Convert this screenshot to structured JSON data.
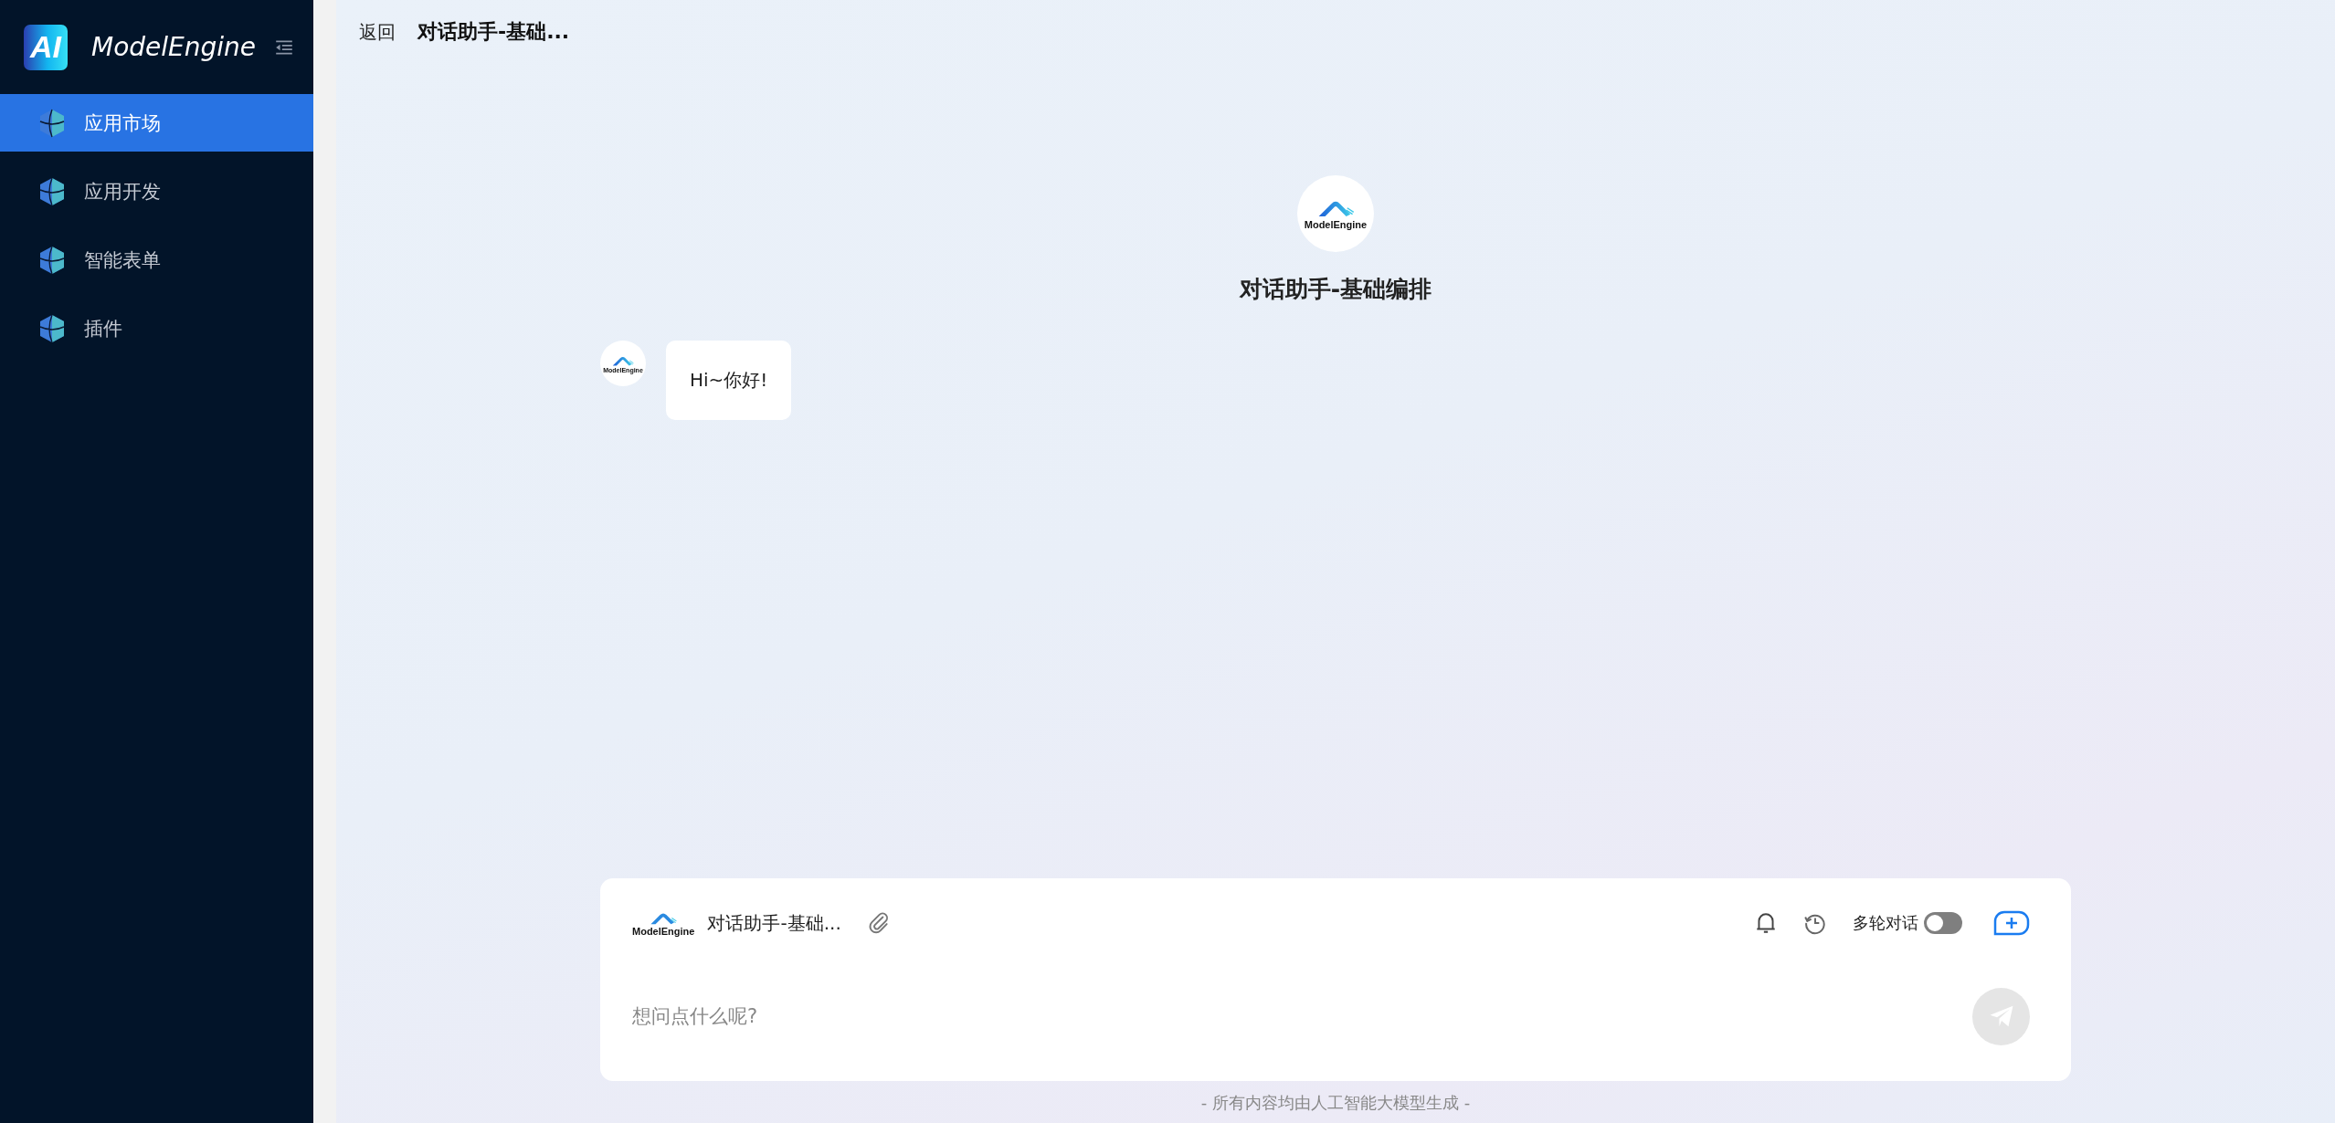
{
  "sidebar": {
    "logo_mark": "AI",
    "brand": "ModelEngine",
    "items": [
      {
        "label": "应用市场",
        "selected": true
      },
      {
        "label": "应用开发",
        "selected": false
      },
      {
        "label": "智能表单",
        "selected": false
      },
      {
        "label": "插件",
        "selected": false
      }
    ]
  },
  "header": {
    "back": "返回",
    "title": "对话助手-基础..."
  },
  "app": {
    "logo_text": "ModelEngine",
    "name": "对话助手-基础编排"
  },
  "messages": [
    {
      "avatar_text": "ModelEngine",
      "text": "Hi~你好!"
    }
  ],
  "composer": {
    "app_logo_text": "ModelEngine",
    "app_name": "对话助手-基础...",
    "multi_turn_label": "多轮对话",
    "multi_turn_on": false,
    "placeholder": "想问点什么呢?"
  },
  "footer": "- 所有内容均由人工智能大模型生成 -"
}
